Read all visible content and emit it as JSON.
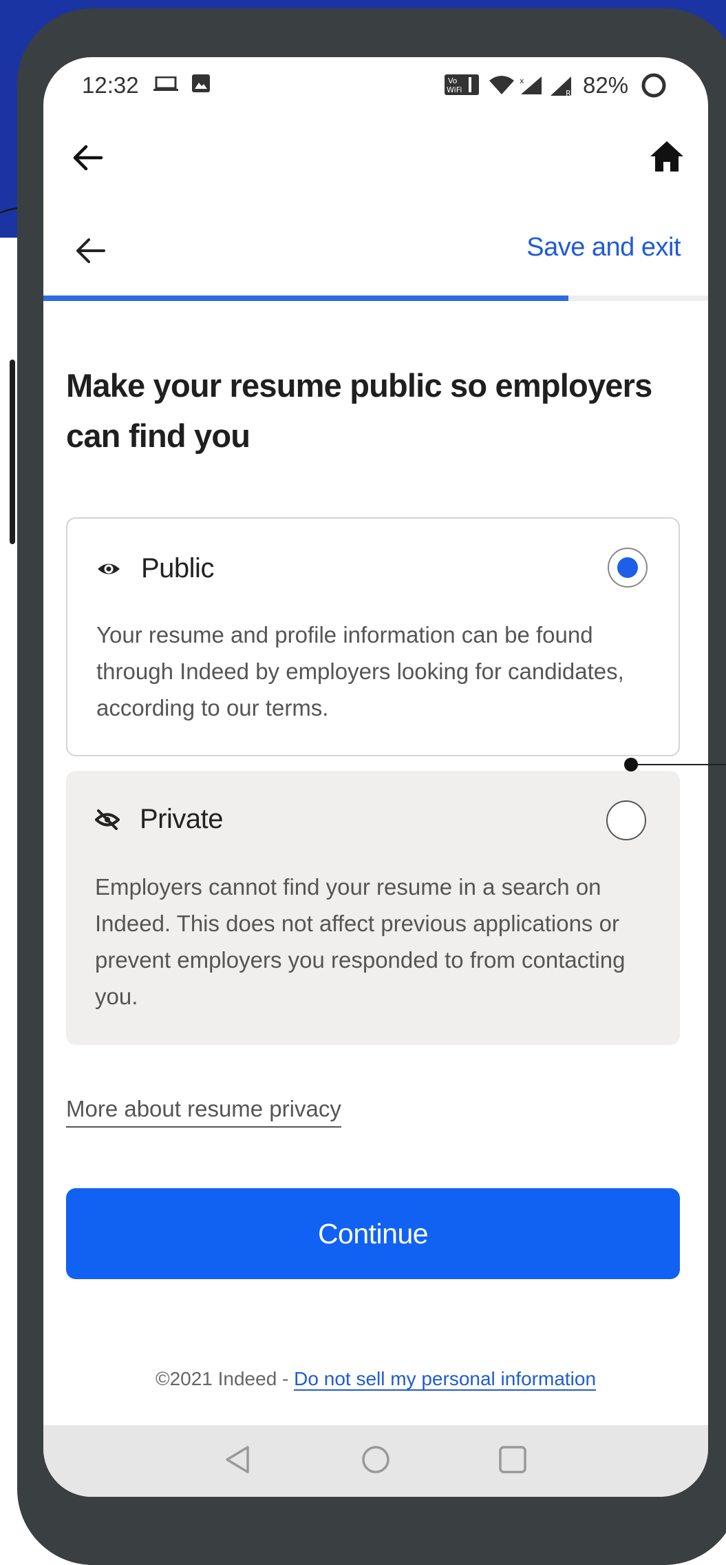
{
  "status_bar": {
    "time": "12:32",
    "battery": "82%",
    "icons": [
      "laptop-icon",
      "image-icon",
      "wifi-calling-icon",
      "wifi-icon",
      "cell-signal-icon",
      "roaming-signal-icon",
      "battery-saver-icon"
    ]
  },
  "top_bar": {
    "back_icon": "arrow-left-icon",
    "home_icon": "home-icon"
  },
  "header": {
    "back_icon": "arrow-left-icon",
    "save_exit": "Save and exit",
    "progress": 0.79
  },
  "page": {
    "title": "Make your resume public so employers can find you",
    "options": [
      {
        "label": "Public",
        "icon": "eye-icon",
        "description": "Your resume and profile information can be found through Indeed by employers looking for candidates, according to our terms.",
        "selected": true
      },
      {
        "label": "Private",
        "icon": "eye-off-icon",
        "description": "Employers cannot find your resume in a search on Indeed. This does not affect previous applications or prevent employers you responded to from contacting you.",
        "selected": false
      }
    ],
    "privacy_link": "More about resume privacy",
    "continue_label": "Continue"
  },
  "footer": {
    "copyright": "©2021 Indeed - ",
    "link": "Do not sell my personal information"
  },
  "nav_bar": {
    "icons": [
      "nav-back-icon",
      "nav-home-icon",
      "nav-recents-icon"
    ]
  },
  "colors": {
    "accent": "#1161f3",
    "link": "#1f5bd6",
    "background_blue": "#1b34a3",
    "phone_frame": "#3a3f42"
  }
}
